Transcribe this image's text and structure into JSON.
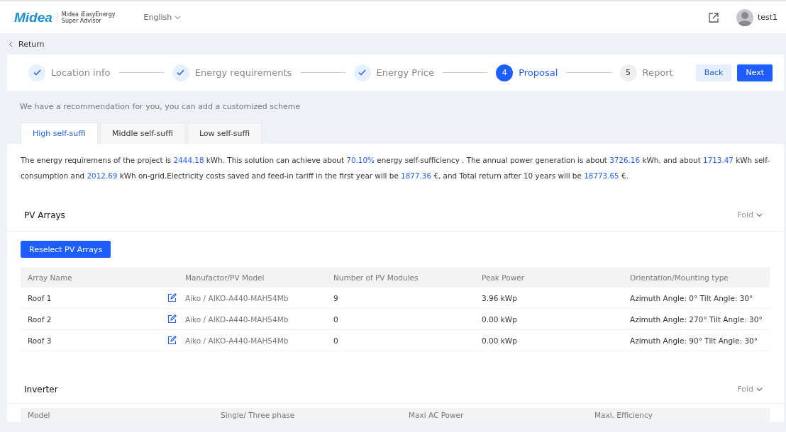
{
  "header": {
    "brand": "Midea",
    "product_lines": [
      "Midea iEasyEnergy",
      "Super Advisor"
    ],
    "language": "English",
    "user": "test1"
  },
  "return_label": "Return",
  "steps": [
    {
      "label": "Location info",
      "done": true,
      "selected": false
    },
    {
      "label": "Energy requirements",
      "done": true,
      "selected": false
    },
    {
      "label": "Energy Price",
      "done": true,
      "selected": false
    },
    {
      "number": "4",
      "label": "Proposal",
      "done": false,
      "selected": true
    },
    {
      "number": "5",
      "label": "Report",
      "done": false,
      "selected": false
    }
  ],
  "step_buttons": [
    {
      "label": "Back",
      "kind": "secondary"
    },
    {
      "label": "Next",
      "kind": "primary"
    }
  ],
  "recommendation": "We have a recommendation for you, you can add a customized scheme",
  "tabs": [
    {
      "label": "High self-suffi",
      "selected": true
    },
    {
      "label": "Middle self-suffi",
      "selected": false
    },
    {
      "label": "Low self-suffi",
      "selected": false
    }
  ],
  "summary": [
    {
      "text": "The energy requiremens of the project is ",
      "kind": "plain"
    },
    {
      "text": "2444.18",
      "kind": "value"
    },
    {
      "text": " kWh. This solution can achieve about ",
      "kind": "plain"
    },
    {
      "text": "70.10%",
      "kind": "value"
    },
    {
      "text": " energy self-sufficiency . The annual power generation is about ",
      "kind": "plain"
    },
    {
      "text": "3726.16",
      "kind": "value"
    },
    {
      "text": " kWh. and about ",
      "kind": "plain"
    },
    {
      "text": "1713.47",
      "kind": "value"
    },
    {
      "text": " kWh self-consumption and ",
      "kind": "plain"
    },
    {
      "text": "2012.69",
      "kind": "value"
    },
    {
      "text": " kWh on-grid.Electricity costs saved and feed-in tariff in the first year will be ",
      "kind": "plain"
    },
    {
      "text": "1877.36",
      "kind": "value"
    },
    {
      "text": " €, and Total return after 10 years will be ",
      "kind": "plain"
    },
    {
      "text": "18773.65",
      "kind": "value"
    },
    {
      "text": " €.",
      "kind": "plain"
    }
  ],
  "pv_arrays": {
    "title": "PV Arrays",
    "fold": "Fold",
    "button": "Reselect PV Arrays",
    "columns": [
      "Array Name",
      "Manufactor/PV Model",
      "Number of PV Modules",
      "Peak Power",
      "Orientation/Mounting type"
    ],
    "rows": [
      {
        "name": "Roof 1",
        "model": "Aiko / AIKO-A440-MAH54Mb",
        "modules": "9",
        "peak": "3.96 kWp",
        "orientation": "Azimuth Angle: 0°  Tilt Angle: 30°"
      },
      {
        "name": "Roof 2",
        "model": "Aiko / AIKO-A440-MAH54Mb",
        "modules": "0",
        "peak": "0.00 kWp",
        "orientation": "Azimuth Angle: 270°  Tilt Angle: 30°"
      },
      {
        "name": "Roof 3",
        "model": "Aiko / AIKO-A440-MAH54Mb",
        "modules": "0",
        "peak": "0.00 kWp",
        "orientation": "Azimuth Angle: 90°  Tilt Angle: 30°"
      }
    ]
  },
  "inverter": {
    "title": "Inverter",
    "fold": "Fold",
    "columns": [
      "Model",
      "Single/ Three phase",
      "Maxi AC Power",
      "Maxi. Efficiency"
    ]
  }
}
